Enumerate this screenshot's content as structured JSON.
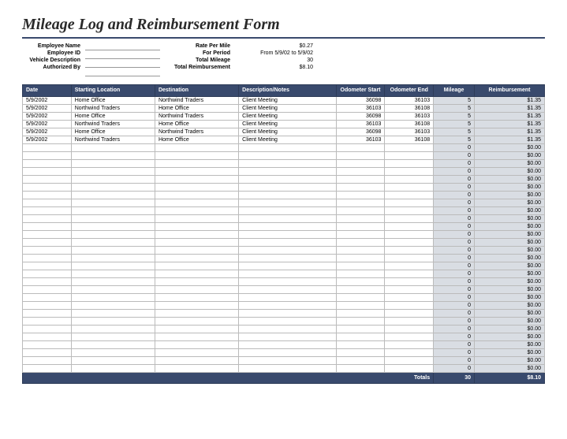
{
  "title": "Mileage Log and Reimbursement Form",
  "meta": {
    "left_labels": [
      "Employee Name",
      "Employee ID",
      "Vehicle Description",
      "Authorized By"
    ],
    "right_labels": [
      "Rate Per Mile",
      "For Period",
      "Total Mileage",
      "Total Reimbursement"
    ],
    "right_values": [
      "$0.27",
      "From 5/9/02 to 5/9/02",
      "30",
      "$8.10"
    ]
  },
  "columns": {
    "date": "Date",
    "start_loc": "Starting Location",
    "destination": "Destination",
    "desc": "Description/Notes",
    "odo_start": "Odometer Start",
    "odo_end": "Odometer End",
    "mileage": "Mileage",
    "reimbursement": "Reimbursement"
  },
  "rows": [
    {
      "date": "5/9/2002",
      "start": "Home Office",
      "dest": "Northwind Traders",
      "desc": "Client Meeting",
      "ostart": "36098",
      "oend": "36103",
      "mileage": "5",
      "reim": "$1.35"
    },
    {
      "date": "5/9/2002",
      "start": "Northwind Traders",
      "dest": "Home Office",
      "desc": "Client Meeting",
      "ostart": "36103",
      "oend": "36108",
      "mileage": "5",
      "reim": "$1.35"
    },
    {
      "date": "5/9/2002",
      "start": "Home Office",
      "dest": "Northwind Traders",
      "desc": "Client Meeting",
      "ostart": "36098",
      "oend": "36103",
      "mileage": "5",
      "reim": "$1.35"
    },
    {
      "date": "5/9/2002",
      "start": "Northwind Traders",
      "dest": "Home Office",
      "desc": "Client Meeting",
      "ostart": "36103",
      "oend": "36108",
      "mileage": "5",
      "reim": "$1.35"
    },
    {
      "date": "5/9/2002",
      "start": "Home Office",
      "dest": "Northwind Traders",
      "desc": "Client Meeting",
      "ostart": "36098",
      "oend": "36103",
      "mileage": "5",
      "reim": "$1.35"
    },
    {
      "date": "5/9/2002",
      "start": "Northwind Traders",
      "dest": "Home Office",
      "desc": "Client Meeting",
      "ostart": "36103",
      "oend": "36108",
      "mileage": "5",
      "reim": "$1.35"
    }
  ],
  "empty_row": {
    "mileage": "0",
    "reim": "$0.00"
  },
  "empty_count": 29,
  "totals": {
    "label": "Totals",
    "mileage": "30",
    "reim": "$8.10"
  }
}
